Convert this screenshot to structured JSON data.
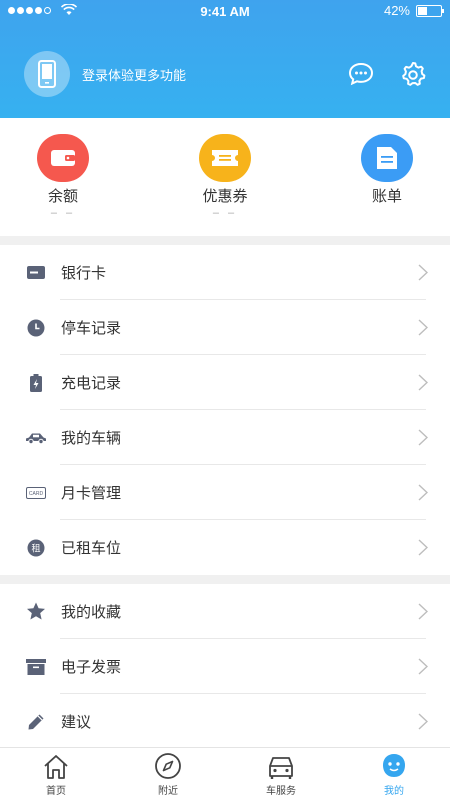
{
  "status_bar": {
    "time": "9:41 AM",
    "battery": "42%",
    "battery_level": 0.42
  },
  "header": {
    "login_text": "登录体验更多功能",
    "message_icon": "chat-bubble-icon",
    "settings_icon": "gear-icon"
  },
  "wallet": {
    "items": [
      {
        "label": "余额",
        "value": "– –",
        "icon": "wallet-icon",
        "color": "#f5584e"
      },
      {
        "label": "优惠券",
        "value": "– –",
        "icon": "coupon-icon",
        "color": "#f7b31b"
      },
      {
        "label": "账单",
        "value": "",
        "icon": "bill-icon",
        "color": "#3b9cf5"
      }
    ]
  },
  "list1": [
    {
      "label": "银行卡",
      "icon": "bank-card-icon"
    },
    {
      "label": "停车记录",
      "icon": "clock-icon"
    },
    {
      "label": "充电记录",
      "icon": "battery-charge-icon"
    },
    {
      "label": "我的车辆",
      "icon": "car-icon"
    },
    {
      "label": "月卡管理",
      "icon": "card-icon",
      "icon_text": "CARD"
    },
    {
      "label": "已租车位",
      "icon": "rent-icon",
      "icon_text": "租"
    }
  ],
  "list2": [
    {
      "label": "我的收藏",
      "icon": "star-icon"
    },
    {
      "label": "电子发票",
      "icon": "invoice-icon"
    },
    {
      "label": "建议",
      "icon": "pencil-icon"
    }
  ],
  "tabbar": {
    "tabs": [
      {
        "label": "首页",
        "icon": "home-icon"
      },
      {
        "label": "附近",
        "icon": "compass-icon"
      },
      {
        "label": "车服务",
        "icon": "car-service-icon"
      },
      {
        "label": "我的",
        "icon": "profile-icon",
        "active": true
      }
    ],
    "accent": "#35a6ef"
  }
}
